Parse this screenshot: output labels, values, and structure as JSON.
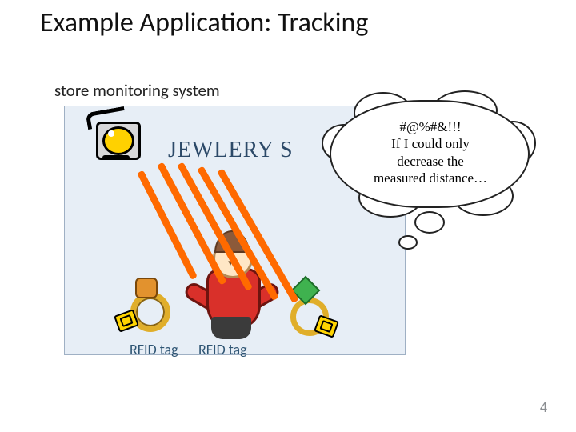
{
  "title": "Example Application: Tracking",
  "subtitle": "store monitoring system",
  "store_title": "JEWLERY S",
  "thought": {
    "line1": "#@%#&!!!",
    "line2": "If I could only",
    "line3": "decrease the",
    "line4": "measured distance…"
  },
  "labels": {
    "rfid_tag": "RFID tag"
  },
  "page_number": "4"
}
